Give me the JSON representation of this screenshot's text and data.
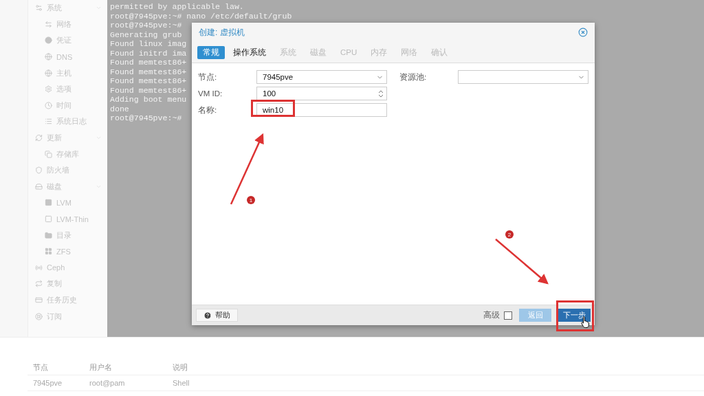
{
  "sidebar": {
    "items": [
      {
        "label": "系统",
        "expanded": true,
        "children": [
          {
            "label": "网络"
          },
          {
            "label": "凭证"
          },
          {
            "label": "DNS"
          },
          {
            "label": "主机"
          },
          {
            "label": "选项"
          },
          {
            "label": "时间"
          },
          {
            "label": "系统日志"
          }
        ]
      },
      {
        "label": "更新",
        "expanded": true,
        "children": [
          {
            "label": "存储库"
          }
        ]
      },
      {
        "label": "防火墙"
      },
      {
        "label": "磁盘",
        "expanded": true,
        "children": [
          {
            "label": "LVM"
          },
          {
            "label": "LVM-Thin"
          },
          {
            "label": "目录"
          },
          {
            "label": "ZFS"
          }
        ]
      },
      {
        "label": "Ceph"
      },
      {
        "label": "复制"
      },
      {
        "label": "任务历史"
      },
      {
        "label": "订阅"
      }
    ]
  },
  "terminal": {
    "lines": [
      "permitted by applicable law.",
      "root@7945pve:~# nano /etc/default/grub",
      "root@7945pve:~#",
      "Generating grub",
      "Found linux imag",
      "Found initrd ima",
      "Found memtest86+",
      "Found memtest86+",
      "Found memtest86+",
      "Found memtest86+",
      "Adding boot menu",
      "done",
      "root@7945pve:~#"
    ]
  },
  "dialog": {
    "title": "创建: 虚拟机",
    "tabs": [
      {
        "label": "常规",
        "selected": true,
        "disabled": false
      },
      {
        "label": "操作系统",
        "selected": false,
        "disabled": false
      },
      {
        "label": "系统",
        "selected": false,
        "disabled": true
      },
      {
        "label": "磁盘",
        "selected": false,
        "disabled": true
      },
      {
        "label": "CPU",
        "selected": false,
        "disabled": true
      },
      {
        "label": "内存",
        "selected": false,
        "disabled": true
      },
      {
        "label": "网络",
        "selected": false,
        "disabled": true
      },
      {
        "label": "确认",
        "selected": false,
        "disabled": true
      }
    ],
    "form_left": [
      {
        "label": "节点:",
        "value": "7945pve",
        "kind": "select"
      },
      {
        "label": "VM ID:",
        "value": "100",
        "kind": "spinner"
      },
      {
        "label": "名称:",
        "value": "win10",
        "kind": "text"
      }
    ],
    "form_right": [
      {
        "label": "资源池:",
        "kind": "select"
      }
    ],
    "help_button": "帮助",
    "advanced": {
      "label": "高级",
      "checked": false
    },
    "back_button": {
      "label": "返回",
      "disabled": true
    },
    "next_button": {
      "label": "下一步",
      "disabled": false
    }
  },
  "annotations": [
    {
      "number": "1"
    },
    {
      "number": "2"
    }
  ],
  "table": {
    "columns": [
      "节点",
      "用户名",
      "说明"
    ],
    "rows": [
      [
        "7945pve",
        "root@pam",
        "Shell"
      ]
    ]
  }
}
